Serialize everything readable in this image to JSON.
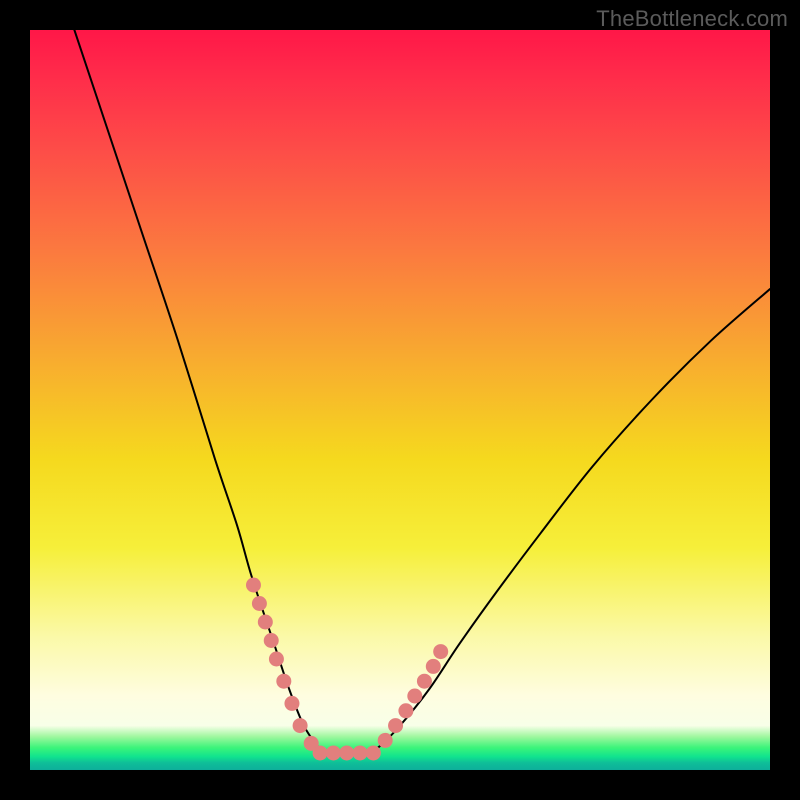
{
  "watermark": "TheBottleneck.com",
  "chart_data": {
    "type": "line",
    "title": "",
    "xlabel": "",
    "ylabel": "",
    "xlim": [
      0,
      100
    ],
    "ylim": [
      0,
      100
    ],
    "grid": false,
    "legend": false,
    "series": [
      {
        "name": "bottleneck-curve",
        "color": "#000000",
        "x": [
          6,
          10,
          15,
          20,
          25,
          28,
          30,
          33,
          35,
          37,
          39,
          40,
          41,
          43,
          45,
          47,
          50,
          54,
          58,
          63,
          69,
          76,
          84,
          92,
          100
        ],
        "values": [
          100,
          88,
          73,
          58,
          42,
          33,
          26,
          17,
          11,
          6,
          3,
          2,
          2,
          2,
          2,
          3,
          6,
          11,
          17,
          24,
          32,
          41,
          50,
          58,
          65
        ]
      }
    ],
    "markers": [
      {
        "name": "left-arm-dots",
        "color": "#e27f7d",
        "points": [
          {
            "x": 30.2,
            "y": 25.0
          },
          {
            "x": 31.0,
            "y": 22.5
          },
          {
            "x": 31.8,
            "y": 20.0
          },
          {
            "x": 32.6,
            "y": 17.5
          },
          {
            "x": 33.3,
            "y": 15.0
          },
          {
            "x": 34.3,
            "y": 12.0
          },
          {
            "x": 35.4,
            "y": 9.0
          },
          {
            "x": 36.5,
            "y": 6.0
          },
          {
            "x": 38.0,
            "y": 3.6
          }
        ]
      },
      {
        "name": "flat-bottom-dots",
        "color": "#e27f7d",
        "points": [
          {
            "x": 39.2,
            "y": 2.3
          },
          {
            "x": 41.0,
            "y": 2.3
          },
          {
            "x": 42.8,
            "y": 2.3
          },
          {
            "x": 44.6,
            "y": 2.3
          },
          {
            "x": 46.4,
            "y": 2.3
          }
        ]
      },
      {
        "name": "right-arm-dots",
        "color": "#e27f7d",
        "points": [
          {
            "x": 48.0,
            "y": 4.0
          },
          {
            "x": 49.4,
            "y": 6.0
          },
          {
            "x": 50.8,
            "y": 8.0
          },
          {
            "x": 52.0,
            "y": 10.0
          },
          {
            "x": 53.3,
            "y": 12.0
          },
          {
            "x": 54.5,
            "y": 14.0
          },
          {
            "x": 55.5,
            "y": 16.0
          }
        ]
      }
    ],
    "gradient_stops": [
      {
        "pct": 0,
        "color": "#ff1748"
      },
      {
        "pct": 30,
        "color": "#fb7a3f"
      },
      {
        "pct": 58,
        "color": "#f5d91e"
      },
      {
        "pct": 90,
        "color": "#fefde0"
      },
      {
        "pct": 97,
        "color": "#3bf47a"
      },
      {
        "pct": 100,
        "color": "#0eae9a"
      }
    ]
  }
}
